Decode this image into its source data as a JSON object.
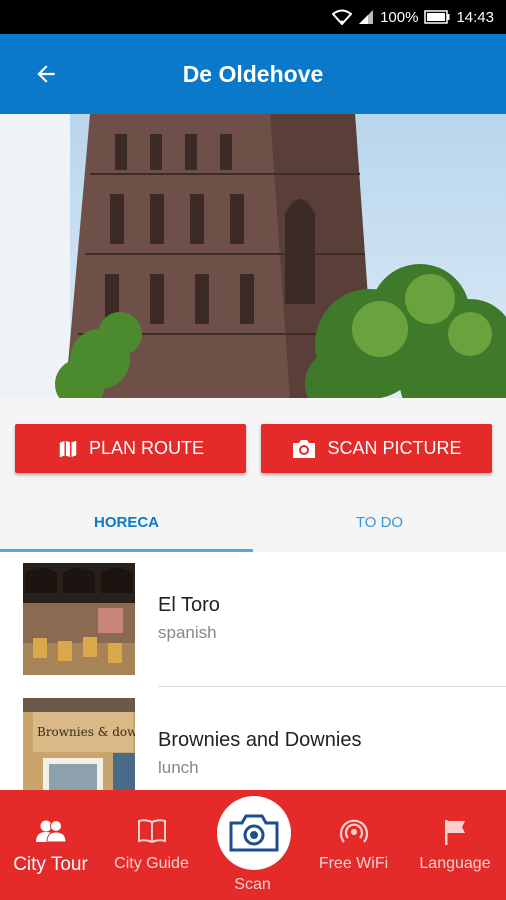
{
  "status_bar": {
    "battery": "100%",
    "time": "14:43"
  },
  "app_bar": {
    "title": "De Oldehove"
  },
  "actions": {
    "plan_route": "PLAN ROUTE",
    "scan_picture": "SCAN PICTURE"
  },
  "tabs": [
    {
      "label": "HORECA"
    },
    {
      "label": "TO DO"
    }
  ],
  "list": [
    {
      "name": "El Toro",
      "category": "spanish"
    },
    {
      "name": "Brownies and Downies",
      "category": "lunch",
      "sign_text": "Brownies & dow"
    }
  ],
  "bottom_nav": [
    {
      "label": "City Tour",
      "icon": "users-icon"
    },
    {
      "label": "City Guide",
      "icon": "book-icon"
    },
    {
      "label": "Scan",
      "icon": "camera-icon"
    },
    {
      "label": "Free WiFi",
      "icon": "wifi-icon"
    },
    {
      "label": "Language",
      "icon": "flag-icon"
    }
  ],
  "colors": {
    "primary": "#0b79c9",
    "accent": "#e52a2a"
  }
}
